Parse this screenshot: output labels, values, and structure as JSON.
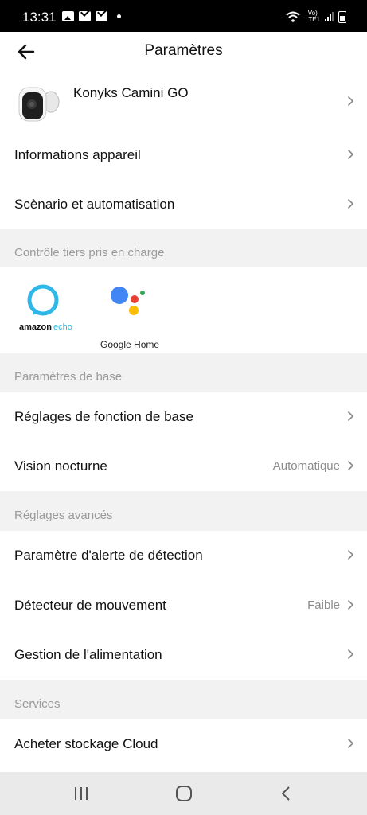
{
  "status": {
    "time": "13:31",
    "volte_line1": "Vo)",
    "volte_line2": "LTE1"
  },
  "header": {
    "title": "Paramètres"
  },
  "device": {
    "name": "Konyks Camini GO"
  },
  "rows": {
    "device_info": "Informations appareil",
    "scenario": "Scènario et automatisation",
    "basic_settings": "Réglages de fonction de base",
    "night_vision": "Vision nocturne",
    "night_vision_value": "Automatique",
    "alert_settings": "Paramètre d'alerte de détection",
    "motion_detector": "Détecteur de mouvement",
    "motion_detector_value": "Faible",
    "power": "Gestion de l'alimentation",
    "cloud": "Acheter stockage Cloud"
  },
  "sections": {
    "third_party": "Contrôle tiers pris en charge",
    "basic": "Paramètres de base",
    "advanced": "Réglages avancés",
    "services": "Services"
  },
  "integrations": {
    "amazon_part1": "amazon",
    "amazon_part2": "echo",
    "google": "Google Home"
  },
  "colors": {
    "accent_amazon": "#2fb7e8",
    "google_blue": "#4285f4",
    "google_red": "#ea4335",
    "google_yellow": "#fbbc05",
    "google_green": "#34a853"
  }
}
